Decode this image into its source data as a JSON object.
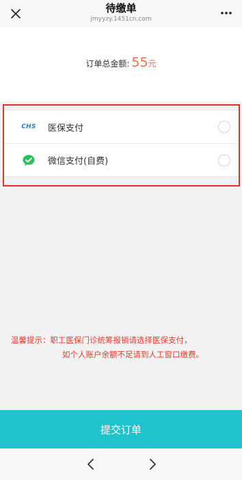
{
  "header": {
    "title": "待缴单",
    "domain": "jmyyzy.1451cn.com"
  },
  "order": {
    "total_label": "订单总金额:",
    "total_value": "55",
    "unit": "元"
  },
  "payment_methods": [
    {
      "icon_text": "CHS",
      "label": "医保支付"
    },
    {
      "label": "微信支付(自费)"
    }
  ],
  "notice": {
    "line1": "温馨提示：职工医保门诊统筹报销请选择医保支付，",
    "line2": "如个人账户余额不足请到人工窗口缴费。"
  },
  "submit_label": "提交订单",
  "colors": {
    "accent": "#1ec3cc",
    "amount": "#ef6b4a",
    "notice": "#e23a2e",
    "highlight_border": "#ee2a2a",
    "wechat_green": "#2bc062"
  }
}
